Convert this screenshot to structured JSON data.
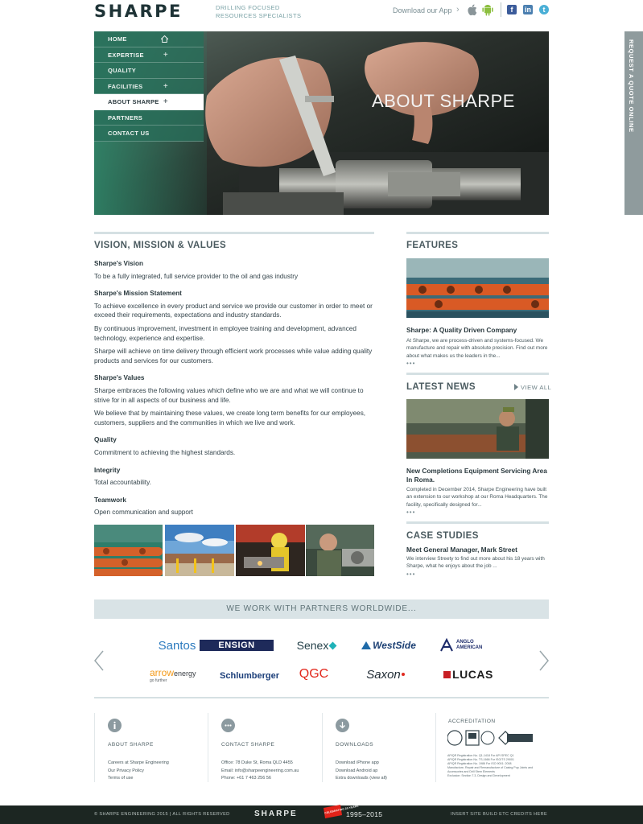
{
  "header": {
    "logo": "SHARPE",
    "tagline_line1": "DRILLING FOCUSED",
    "tagline_line2": "RESOURCES SPECIALISTS",
    "app_label": "Download our App"
  },
  "quote_tab": "REQUEST A QUOTE ONLINE",
  "nav": [
    {
      "label": "HOME"
    },
    {
      "label": "EXPERTISE",
      "expand": "+"
    },
    {
      "label": "QUALITY"
    },
    {
      "label": "FACILITIES",
      "expand": "+"
    },
    {
      "label": "ABOUT SHARPE",
      "expand": "+"
    },
    {
      "label": "PARTNERS"
    },
    {
      "label": "CONTACT US"
    }
  ],
  "hero": {
    "title": "ABOUT SHARPE"
  },
  "vmv": {
    "title": "VISION, MISSION & VALUES",
    "vision_h": "Sharpe's Vision",
    "vision_p": "To be a fully integrated, full service provider to the oil and gas industry",
    "mission_h": "Sharpe's Mission Statement",
    "mission_p1": "To achieve excellence in every product and service we provide our customer in order to meet or exceed their requirements, expectations and industry standards.",
    "mission_p2": "By continuous improvement, investment in employee training and development, advanced technology, experience and expertise.",
    "mission_p3": "Sharpe will achieve on time delivery through efficient work processes while value adding quality products and services for our customers.",
    "values_h": "Sharpe's Values",
    "values_p1": "Sharpe embraces the following values which define who we are and what we will continue to strive for in all aspects of our business and life.",
    "values_p2": "We believe that by maintaining these values, we create long term benefits for our employees, customers, suppliers and the communities in which we live and work.",
    "quality_h": "Quality",
    "quality_p": "Commitment to achieving the highest standards.",
    "integrity_h": "Integrity",
    "integrity_p": "Total accountability.",
    "teamwork_h": "Teamwork",
    "teamwork_p": "Open communication and support"
  },
  "features": {
    "title": "FEATURES",
    "heading": "Sharpe: A Quality Driven Company",
    "text": "At Sharpe, we are process-driven and systems-focused. We manufacture and repair with absolute precision. Find out more about what makes us the leaders in the...",
    "more": "•••"
  },
  "news": {
    "title": "LATEST NEWS",
    "view_all": "VIEW ALL",
    "heading": "New Completions Equipment Servicing Area In Roma.",
    "text": "Completed in December 2014, Sharpe Engineering have built an extension to our workshop at our Roma Headquarters. The facility, specifically designed for...",
    "more": "•••"
  },
  "case_studies": {
    "title": "CASE STUDIES",
    "heading": "Meet General Manager, Mark Street",
    "text": "We interview Streety to find out more about his 18 years with Sharpe, what he enjoys about the job ...",
    "more": "•••"
  },
  "partners": {
    "title": "WE WORK WITH PARTNERS WORLDWIDE...",
    "logos": [
      "Santos",
      "ENSIGN",
      "Senex",
      "WestSide",
      "ANGLO",
      "AMERICAN",
      "arrow",
      "energy",
      "go further",
      "Schlumberger",
      "QGC",
      "Saxon",
      "LUCAS"
    ]
  },
  "footer": {
    "about": {
      "title": "ABOUT SHARPE",
      "links": [
        "Careers at Sharpe Engineering",
        "Our Privacy Policy",
        "Terms of use"
      ]
    },
    "contact": {
      "title": "CONTACT SHARPE",
      "lines": [
        "Office: 78 Duke St, Roma QLD 4455",
        "Email: info@sharpeengineering.com.au",
        "Phone: +61 7 463 256 56"
      ]
    },
    "downloads": {
      "title": "DOWNLOADS",
      "links": [
        "Download iPhone app",
        "Download Android ap",
        "Extra downloads (view all)"
      ]
    },
    "accreditation": {
      "title": "ACCREDITATION",
      "lines": [
        "APIQR Registration No. Q1-1418 For API SPEC Q1",
        "APIQR Registration No. TS-1666 For ISO/TS 29001",
        "APIQR Registration No. 1986 For ISO 9001: 2008",
        "Manufacture, Repair and Remanufacture of Casing Pup Joints and Accessories and Drill Stem Elements",
        "Exclusion: Section 7.3, Design and Development"
      ]
    }
  },
  "bottom_bar": {
    "copyright": "© SHARPE ENGINEERING 2015  |  ALL RIGHTS RESERVED",
    "logo": "SHARPE",
    "badge": "CELEBRATING 20 YEARS",
    "years": "1995–2015",
    "credits": "INSERT SITE BUILD ETC CREDITS HERE"
  }
}
